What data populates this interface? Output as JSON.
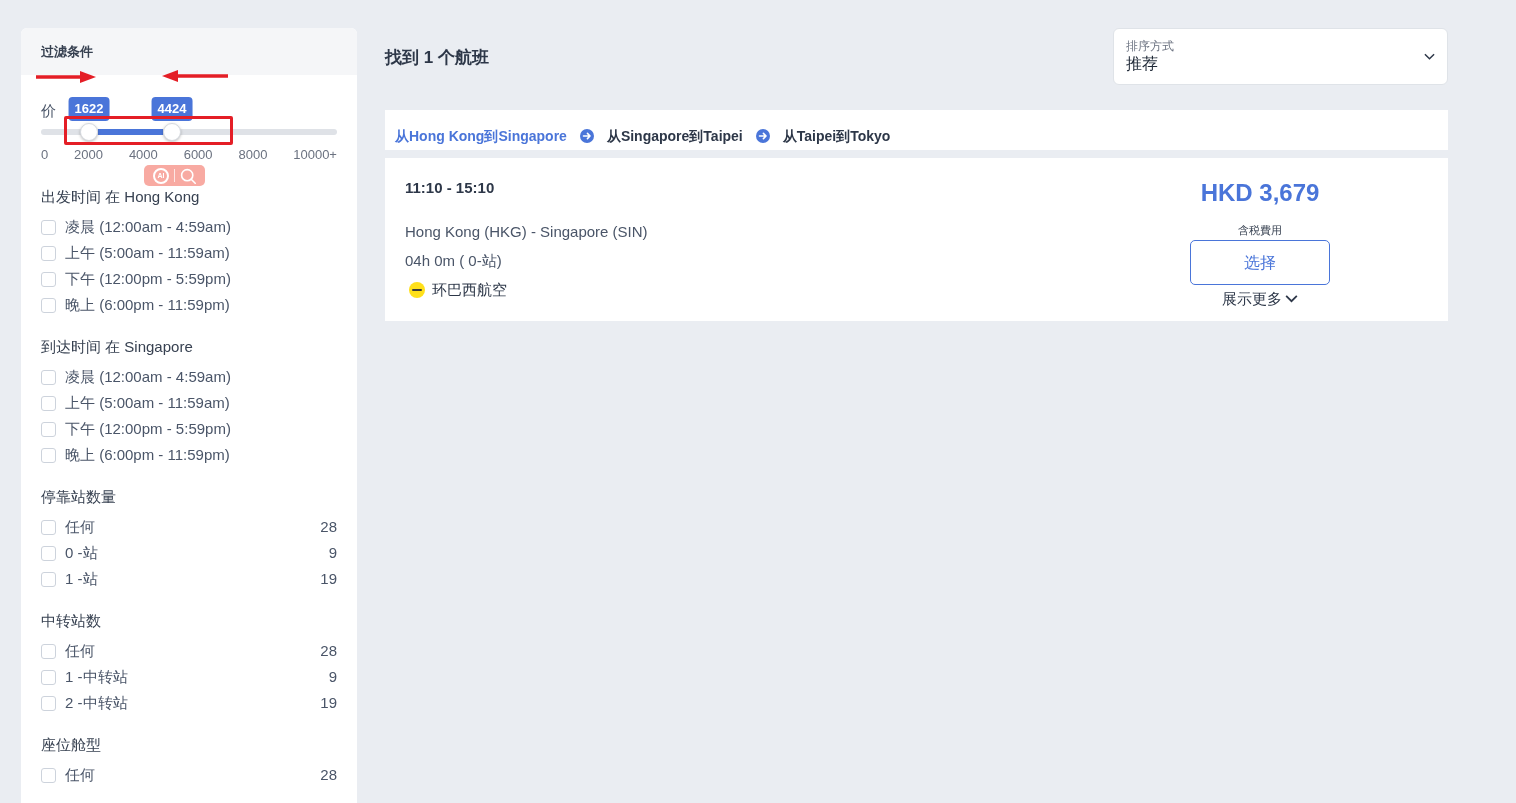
{
  "filters": {
    "title": "过滤条件",
    "price": {
      "label": "价",
      "min": {
        "value": "1622",
        "level": 0.1622
      },
      "max": {
        "value": "4424",
        "level": 0.4424
      },
      "ticks": [
        "0",
        "2000",
        "4000",
        "6000",
        "8000",
        "10000+"
      ]
    },
    "groups": [
      {
        "title": "出发时间 在 Hong Kong",
        "options": [
          {
            "label": "凌晨 (12:00am - 4:59am)",
            "checked": false
          },
          {
            "label": "上午 (5:00am - 11:59am)",
            "checked": false
          },
          {
            "label": "下午 (12:00pm - 5:59pm)",
            "checked": false
          },
          {
            "label": "晚上 (6:00pm - 11:59pm)",
            "checked": false
          }
        ]
      },
      {
        "title": "到达时间 在 Singapore",
        "options": [
          {
            "label": "凌晨 (12:00am - 4:59am)",
            "checked": false
          },
          {
            "label": "上午 (5:00am - 11:59am)",
            "checked": false
          },
          {
            "label": "下午 (12:00pm - 5:59pm)",
            "checked": false
          },
          {
            "label": "晚上 (6:00pm - 11:59pm)",
            "checked": false
          }
        ]
      },
      {
        "title": "停靠站数量",
        "options": [
          {
            "label": "任何",
            "count": "28",
            "checked": false
          },
          {
            "label": "0 -站",
            "count": "9",
            "checked": false
          },
          {
            "label": "1 -站",
            "count": "19",
            "checked": false
          }
        ]
      },
      {
        "title": "中转站数",
        "options": [
          {
            "label": "任何",
            "count": "28",
            "checked": false
          },
          {
            "label": "1 -中转站",
            "count": "9",
            "checked": false
          },
          {
            "label": "2 -中转站",
            "count": "19",
            "checked": false
          }
        ]
      },
      {
        "title": "座位舱型",
        "options": [
          {
            "label": "任何",
            "count": "28",
            "checked": false
          }
        ]
      }
    ]
  },
  "results": {
    "heading": "找到 1 个航班",
    "sort": {
      "label": "排序方式",
      "value": "推荐"
    },
    "legs": [
      {
        "label": "从Hong Kong到Singapore",
        "selected": true
      },
      {
        "label": "从Singapore到Taipei",
        "selected": false
      },
      {
        "label": "从Taipei到Tokyo",
        "selected": false
      }
    ],
    "flights": [
      {
        "times": "11:10 - 15:10",
        "route": "Hong Kong (HKG) - Singapore (SIN)",
        "duration": "04h 0m ( 0-站)",
        "airline": "环巴西航空",
        "price": "HKD 3,679",
        "price_note": "含税費用",
        "select_label": "选择",
        "more_label": "展示更多"
      }
    ]
  },
  "overlay_toolbar": {
    "ai_label": "AI"
  }
}
